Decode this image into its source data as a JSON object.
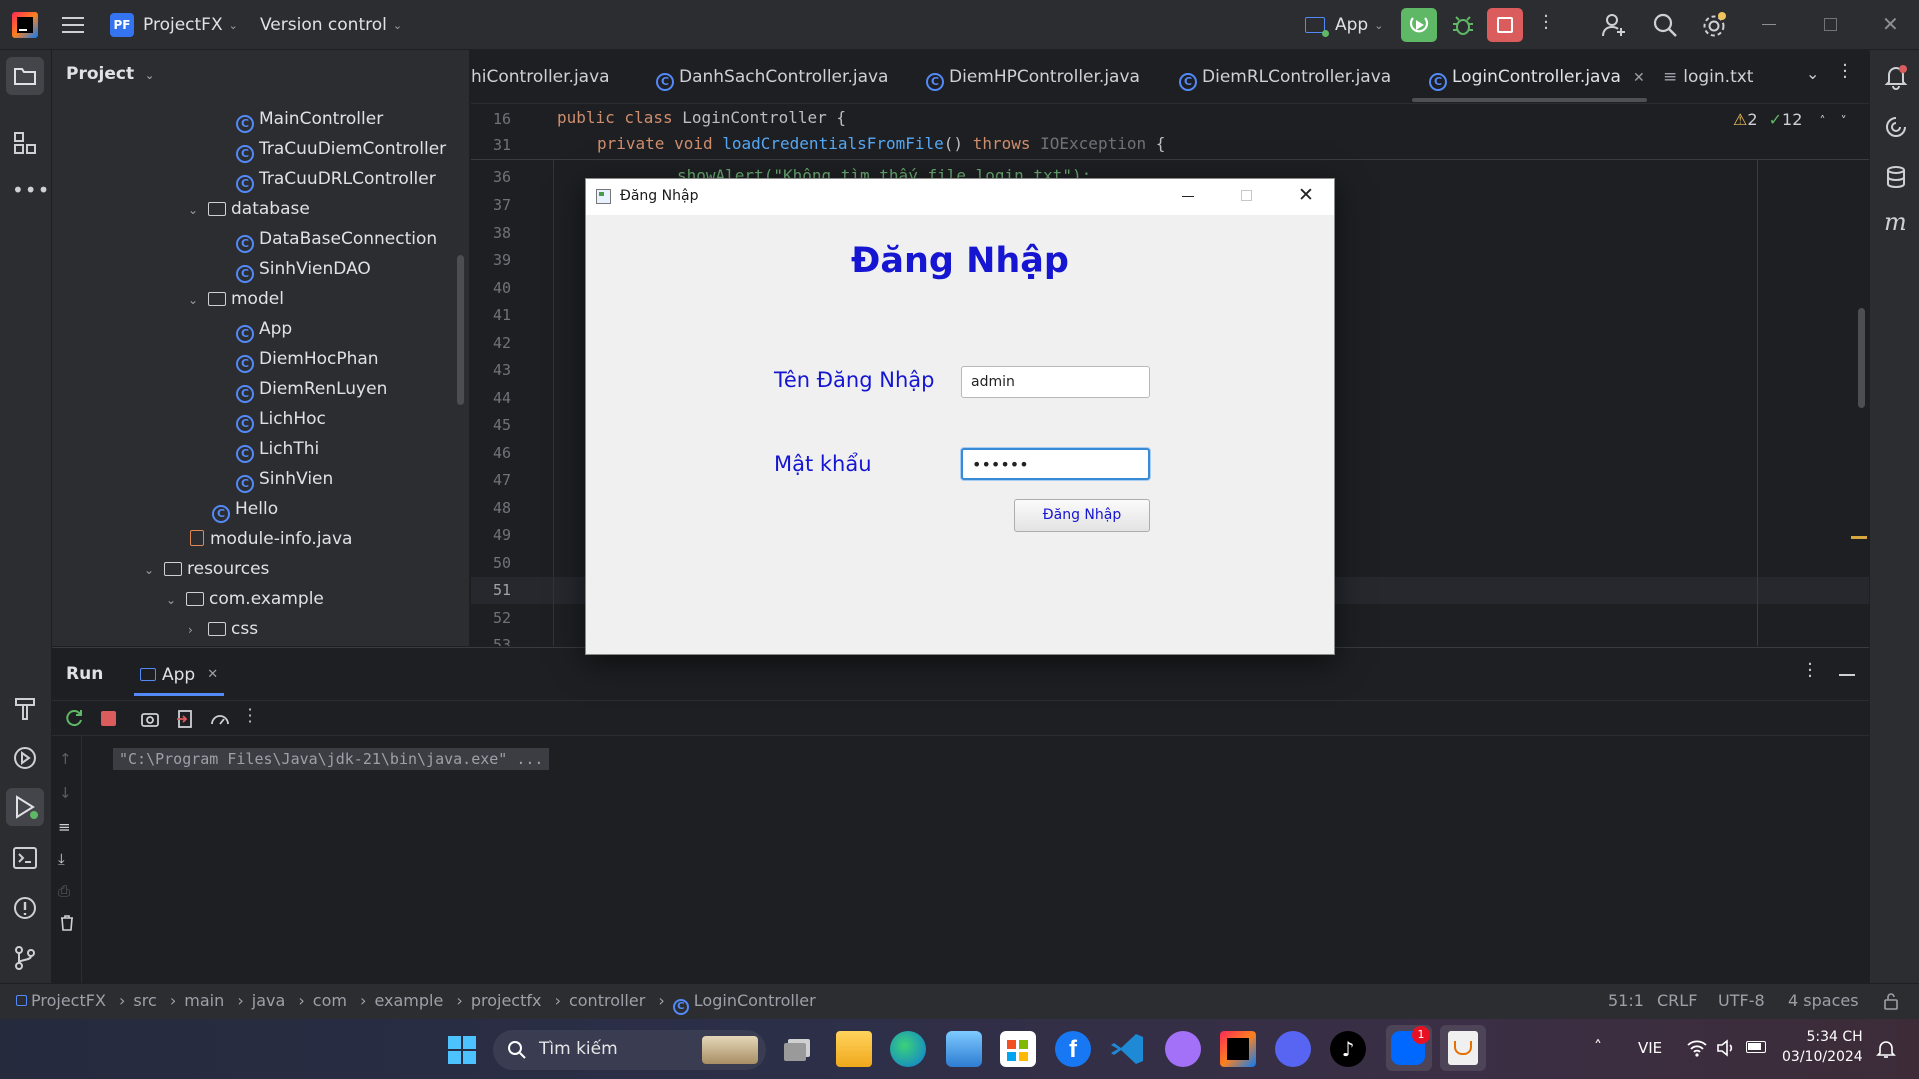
{
  "titlebar": {
    "project_badge": "PF",
    "project_name": "ProjectFX",
    "vcs_label": "Version control",
    "run_config": "App"
  },
  "project_panel": {
    "title": "Project",
    "items": [
      {
        "label": "MainController",
        "kind": "class"
      },
      {
        "label": "TraCuuDiemController",
        "kind": "class"
      },
      {
        "label": "TraCuuDRLController",
        "kind": "class"
      },
      {
        "label": "database",
        "kind": "folder"
      },
      {
        "label": "DataBaseConnection",
        "kind": "class"
      },
      {
        "label": "SinhVienDAO",
        "kind": "class"
      },
      {
        "label": "model",
        "kind": "folder"
      },
      {
        "label": "App",
        "kind": "class"
      },
      {
        "label": "DiemHocPhan",
        "kind": "class"
      },
      {
        "label": "DiemRenLuyen",
        "kind": "class"
      },
      {
        "label": "LichHoc",
        "kind": "class"
      },
      {
        "label": "LichThi",
        "kind": "class"
      },
      {
        "label": "SinhVien",
        "kind": "class"
      },
      {
        "label": "Hello",
        "kind": "class"
      },
      {
        "label": "module-info.java",
        "kind": "file"
      },
      {
        "label": "resources",
        "kind": "folder"
      },
      {
        "label": "com.example",
        "kind": "folder"
      },
      {
        "label": "css",
        "kind": "folder"
      }
    ]
  },
  "editor": {
    "tabs": [
      {
        "label": "hiController.java"
      },
      {
        "label": "DanhSachController.java"
      },
      {
        "label": "DiemHPController.java"
      },
      {
        "label": "DiemRLController.java"
      },
      {
        "label": "LoginController.java"
      },
      {
        "label": "login.txt"
      }
    ],
    "warnings": "2",
    "checks": "12",
    "sticky_lines": [
      {
        "num": "16",
        "code_kw": "public class ",
        "code_rest": "LoginController {"
      },
      {
        "num": "31",
        "code_kw": "private void ",
        "code_fn": "loadCredentialsFromFile",
        "code_mid": "() ",
        "code_kw2": "throws ",
        "code_ty": "IOException",
        "code_end": " {"
      }
    ],
    "line_numbers": [
      "36",
      "37",
      "38",
      "39",
      "40",
      "41",
      "42",
      "43",
      "44",
      "45",
      "46",
      "47",
      "48",
      "49",
      "50",
      "51",
      "52",
      "53"
    ],
    "line36_code": "showAlert(\"Không tìm thấy file login.txt\");"
  },
  "dialog": {
    "title": "Đăng Nhập",
    "heading": "Đăng Nhập",
    "username_label": "Tên Đăng Nhập",
    "username_value": "admin",
    "password_label": "Mật khẩu",
    "password_value": "••••••",
    "login_button": "Đăng Nhập"
  },
  "run_panel": {
    "title": "Run",
    "tab": "App",
    "console_line": "\"C:\\Program Files\\Java\\jdk-21\\bin\\java.exe\" ..."
  },
  "statusbar": {
    "breadcrumb": [
      "ProjectFX",
      "src",
      "main",
      "java",
      "com",
      "example",
      "projectfx",
      "controller",
      "LoginController"
    ],
    "position": "51:1",
    "line_ending": "CRLF",
    "encoding": "UTF-8",
    "indent": "4 spaces"
  },
  "taskbar": {
    "search_placeholder": "Tìm kiếm",
    "language": "VIE",
    "time": "5:34 CH",
    "date": "03/10/2024",
    "zalo_badge": "1"
  }
}
